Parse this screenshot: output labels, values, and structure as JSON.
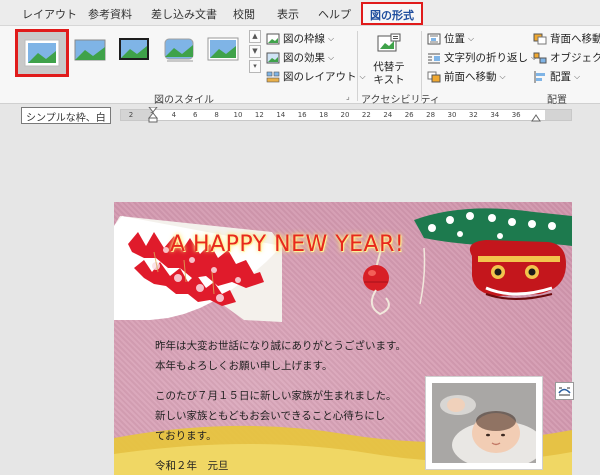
{
  "tabs": [
    {
      "label": "レイアウト"
    },
    {
      "label": "参考資料"
    },
    {
      "label": "差し込み文書"
    },
    {
      "label": "校閲"
    },
    {
      "label": "表示"
    },
    {
      "label": "ヘルプ"
    },
    {
      "label": "図の形式",
      "active": true
    }
  ],
  "picture_styles": {
    "group_label": "図のスタイル",
    "selected_index": 0,
    "commands": {
      "border": "図の枠線",
      "effects": "図の効果",
      "layout": "図のレイアウト"
    }
  },
  "accessibility": {
    "alt_text_line1": "代替テ",
    "alt_text_line2": "キスト",
    "group_label": "アクセシビリティ"
  },
  "arrange": {
    "position": "位置",
    "wrap_text": "文字列の折り返し",
    "bring_forward": "前面へ移動",
    "send_backward": "背面へ移動",
    "selection_pane": "オブジェクトの",
    "align": "配置",
    "group_label": "配置"
  },
  "tooltip": "シンプルな枠、白",
  "ruler": {
    "ticks": [
      "2",
      "2",
      "4",
      "6",
      "8",
      "10",
      "12",
      "14",
      "16",
      "18",
      "20",
      "22",
      "24",
      "26",
      "28",
      "30",
      "32",
      "34",
      "36"
    ]
  },
  "document": {
    "title": "A HAPPY NEW YEAR!",
    "lines": [
      "昨年は大変お世話になり誠にありがとうございます。",
      "本年もよろしくお願い申し上げます。",
      "このたび７月１５日に新しい家族が生まれました。",
      "新しい家族ともどもお会いできること心待ちにし",
      "ております。",
      "令和２年　元旦"
    ]
  },
  "icons": {
    "border": "picture-border-icon",
    "effects": "picture-effects-icon",
    "layout": "picture-layout-icon",
    "alt_text": "alt-text-icon",
    "position": "position-icon",
    "wrap": "wrap-text-icon",
    "forward": "bring-forward-icon",
    "backward": "send-backward-icon",
    "selection": "selection-pane-icon",
    "align": "align-icon",
    "layout_options": "layout-options-icon"
  },
  "colors": {
    "accent_red": "#e01b1b",
    "active_tab_text": "#1f4e9e",
    "title_red": "#e8291c"
  }
}
